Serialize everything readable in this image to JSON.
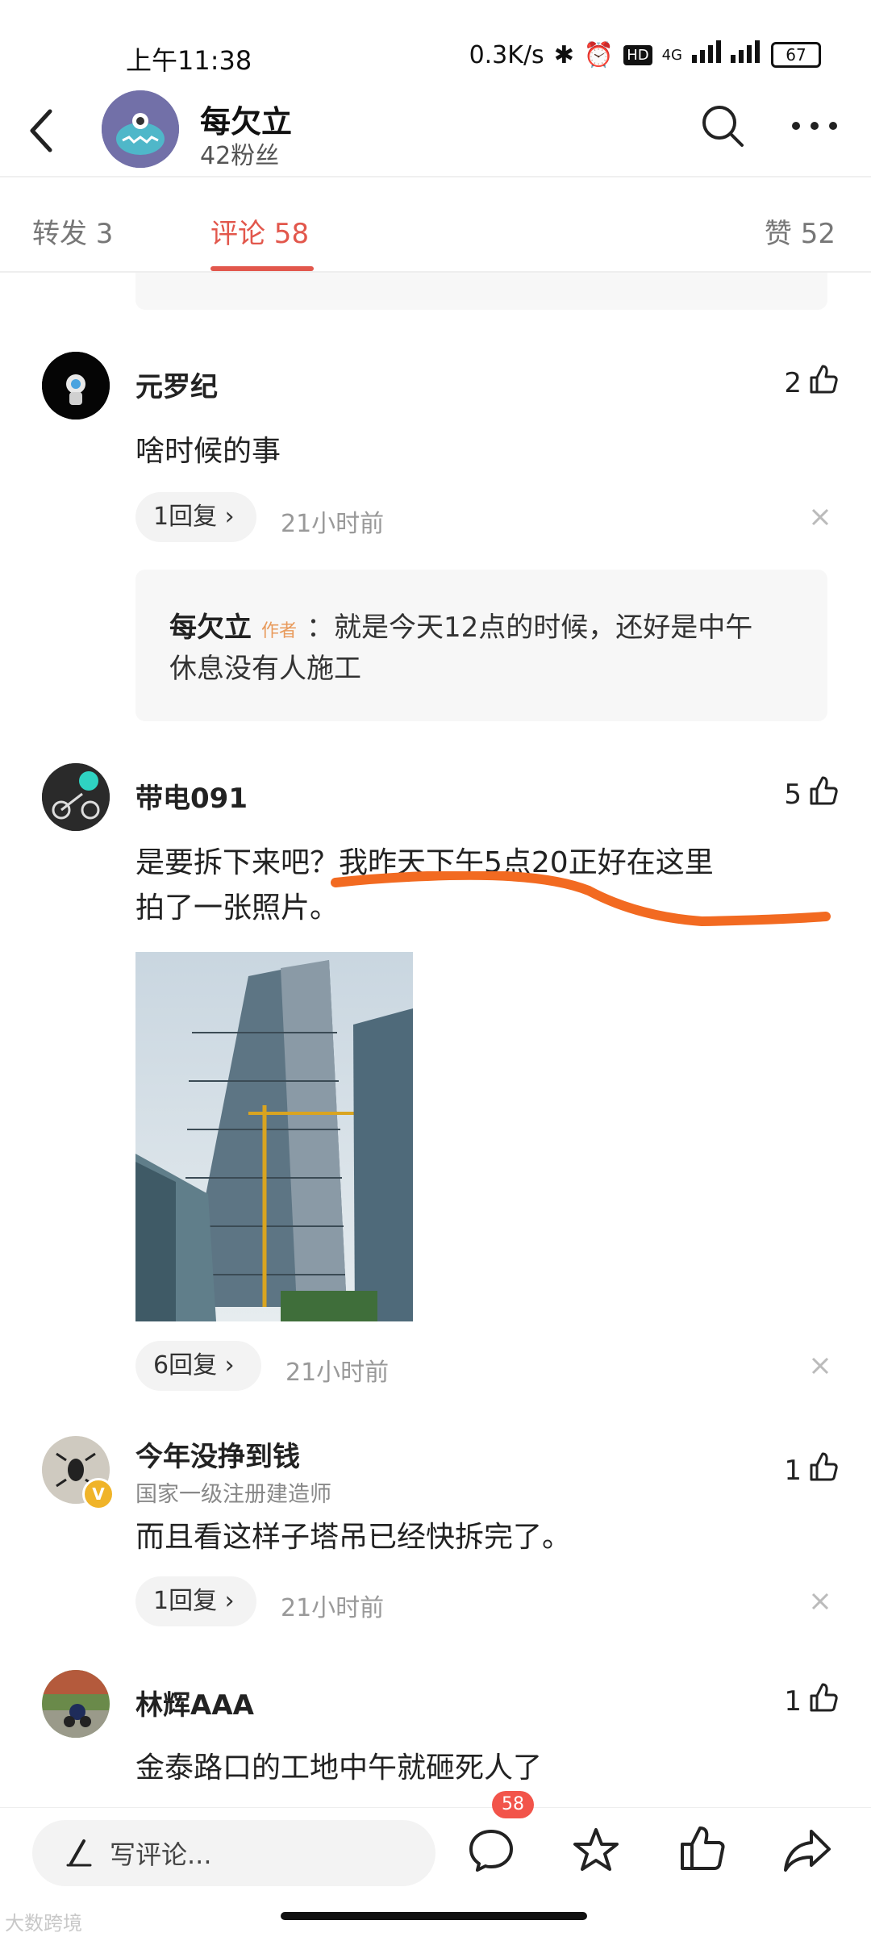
{
  "status": {
    "time": "上午11:38",
    "speed": "0.3K/s",
    "network": "4G",
    "battery": "67"
  },
  "header": {
    "name": "每欠立",
    "fans": "42粉丝"
  },
  "tabs": [
    {
      "label": "转发 3"
    },
    {
      "label": "评论 58"
    },
    {
      "label": "赞 52"
    }
  ],
  "comments": [
    {
      "name": "元罗纪",
      "likes": "2",
      "text": "啥时候的事",
      "replies": "1回复",
      "time": "21小时前",
      "sub_reply": {
        "name": "每欠立",
        "tag": "作者",
        "text_line1": "：就是今天12点的时候，还好是中午",
        "text_line2": "休息没有人施工"
      }
    },
    {
      "name": "带电091",
      "likes": "5",
      "text_line1": "是要拆下来吧？我昨天下午5点20正好在这里",
      "text_line2": "拍了一张照片。",
      "replies": "6回复",
      "time": "21小时前"
    },
    {
      "name": "今年没挣到钱",
      "title": "国家一级注册建造师",
      "likes": "1",
      "text": "而且看这样子塔吊已经快拆完了。",
      "replies": "1回复",
      "time": "21小时前"
    },
    {
      "name": "林辉AAA",
      "likes": "1",
      "text": "金泰路口的工地中午就砸死人了"
    }
  ],
  "bottom": {
    "write_placeholder": "写评论...",
    "comment_badge": "58"
  },
  "watermark": "大数跨境",
  "colors": {
    "accent": "#e2574c",
    "highlight": "#f26a21",
    "verified": "#f0b429"
  }
}
